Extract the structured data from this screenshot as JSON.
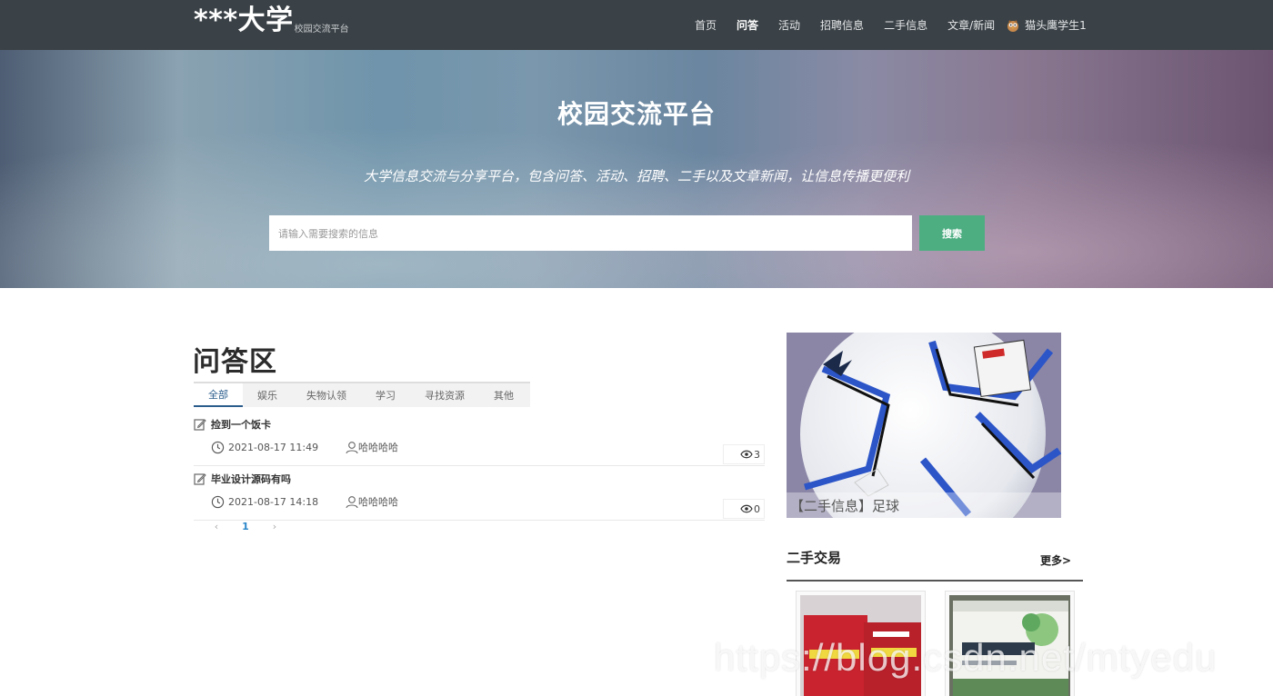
{
  "nav": {
    "brand": "***大学",
    "brand_sub": "校园交流平台",
    "items": [
      {
        "label": "首页",
        "active": false
      },
      {
        "label": "问答",
        "active": true
      },
      {
        "label": "活动",
        "active": false
      },
      {
        "label": "招聘信息",
        "active": false
      },
      {
        "label": "二手信息",
        "active": false
      },
      {
        "label": "文章/新闻",
        "active": false
      }
    ],
    "user": "猫头鹰学生1"
  },
  "hero": {
    "title": "校园交流平台",
    "subtitle": "大学信息交流与分享平台，包含问答、活动、招聘、二手以及文章新闻，让信息传播更便利",
    "search_placeholder": "请输入需要搜索的信息",
    "search_button": "搜索"
  },
  "qa": {
    "title": "问答区",
    "tabs": [
      "全部",
      "娱乐",
      "失物认领",
      "学习",
      "寻找资源",
      "其他"
    ],
    "questions": [
      {
        "title": "捡到一个饭卡",
        "time": "2021-08-17 11:49",
        "author": "哈哈哈哈",
        "views": "3"
      },
      {
        "title": "毕业设计源码有吗",
        "time": "2021-08-17 14:18",
        "author": "哈哈哈哈",
        "views": "0"
      }
    ],
    "pager": {
      "prev": "‹",
      "current": "1",
      "next": "›"
    }
  },
  "feature": {
    "caption": "【二手信息】足球"
  },
  "trade": {
    "title": "二手交易",
    "more": "更多>"
  },
  "watermark": "https://blog.csdn.net/mtyedu",
  "colors": {
    "navbar": "#3b4247",
    "search_button": "#4dae82",
    "tab_active": "#2b5d8c",
    "pager_active": "#2a86c9"
  }
}
